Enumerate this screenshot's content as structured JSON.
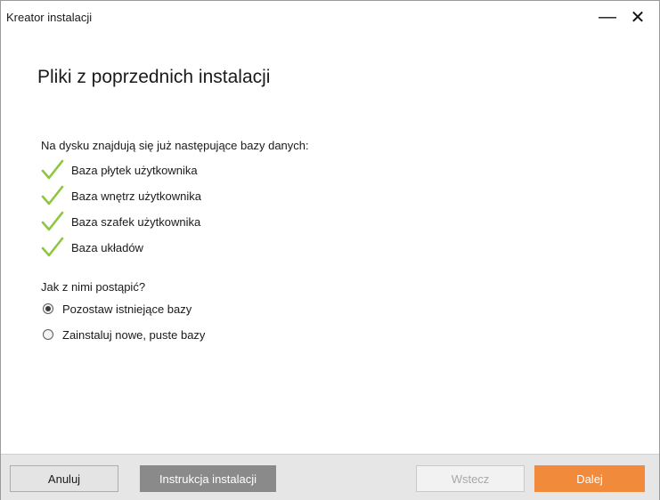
{
  "window": {
    "title": "Kreator instalacji",
    "minimize_glyph": "—",
    "close_glyph": "✕"
  },
  "main": {
    "heading": "Pliki z poprzednich instalacji",
    "intro": "Na dysku znajdują się już następujące bazy danych:",
    "databases": [
      {
        "label": "Baza płytek użytkownika",
        "icon": "check-icon"
      },
      {
        "label": "Baza wnętrz użytkownika",
        "icon": "check-icon"
      },
      {
        "label": "Baza szafek użytkownika",
        "icon": "check-icon"
      },
      {
        "label": "Baza układów",
        "icon": "check-icon"
      }
    ],
    "question": "Jak z nimi postąpić?",
    "options": [
      {
        "label": "Pozostaw istniejące bazy",
        "selected": true
      },
      {
        "label": "Zainstaluj nowe, puste bazy",
        "selected": false
      }
    ]
  },
  "footer": {
    "cancel_label": "Anuluj",
    "manual_label": "Instrukcja instalacji",
    "back_label": "Wstecz",
    "next_label": "Dalej"
  },
  "colors": {
    "accent": "#f18a3a",
    "check": "#8dc63f",
    "manual_button": "#8a8a8a"
  }
}
